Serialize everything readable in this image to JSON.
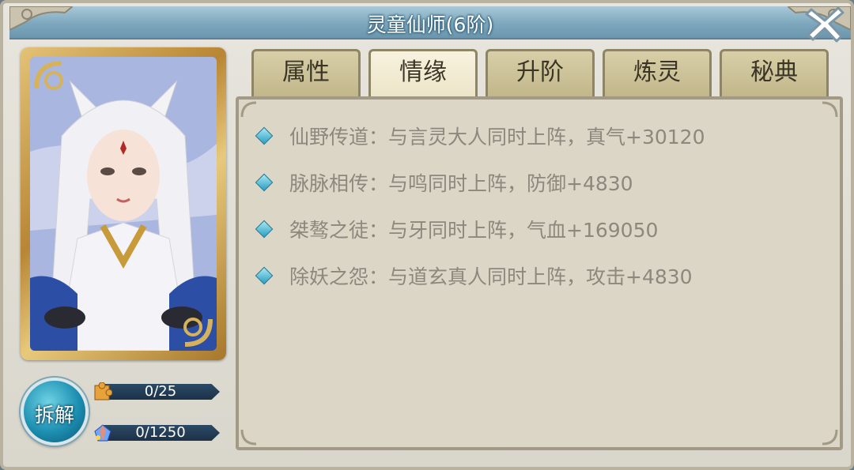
{
  "window": {
    "title": "灵童仙师(6阶)"
  },
  "tabs": [
    {
      "label": "属性",
      "active": false
    },
    {
      "label": "情缘",
      "active": true
    },
    {
      "label": "升阶",
      "active": false
    },
    {
      "label": "炼灵",
      "active": false
    },
    {
      "label": "秘典",
      "active": false
    }
  ],
  "fates": [
    {
      "text": "仙野传道：与言灵大人同时上阵，真气+30120"
    },
    {
      "text": "脉脉相传：与鸣同时上阵，防御+4830"
    },
    {
      "text": "桀骜之徒：与牙同时上阵，气血+169050"
    },
    {
      "text": "除妖之怨：与道玄真人同时上阵，攻击+4830"
    }
  ],
  "decompose": {
    "label": "拆解"
  },
  "resources": [
    {
      "icon": "puzzle-fragment-icon",
      "value": "0/25"
    },
    {
      "icon": "spirit-crystal-icon",
      "value": "0/1250"
    }
  ],
  "colors": {
    "title_bar": "#7da7bd",
    "tab_active": "#f7f2df",
    "fate_text": "#8c887d",
    "diamond": "#2c9ec2",
    "portrait_frame": "#b88634"
  }
}
